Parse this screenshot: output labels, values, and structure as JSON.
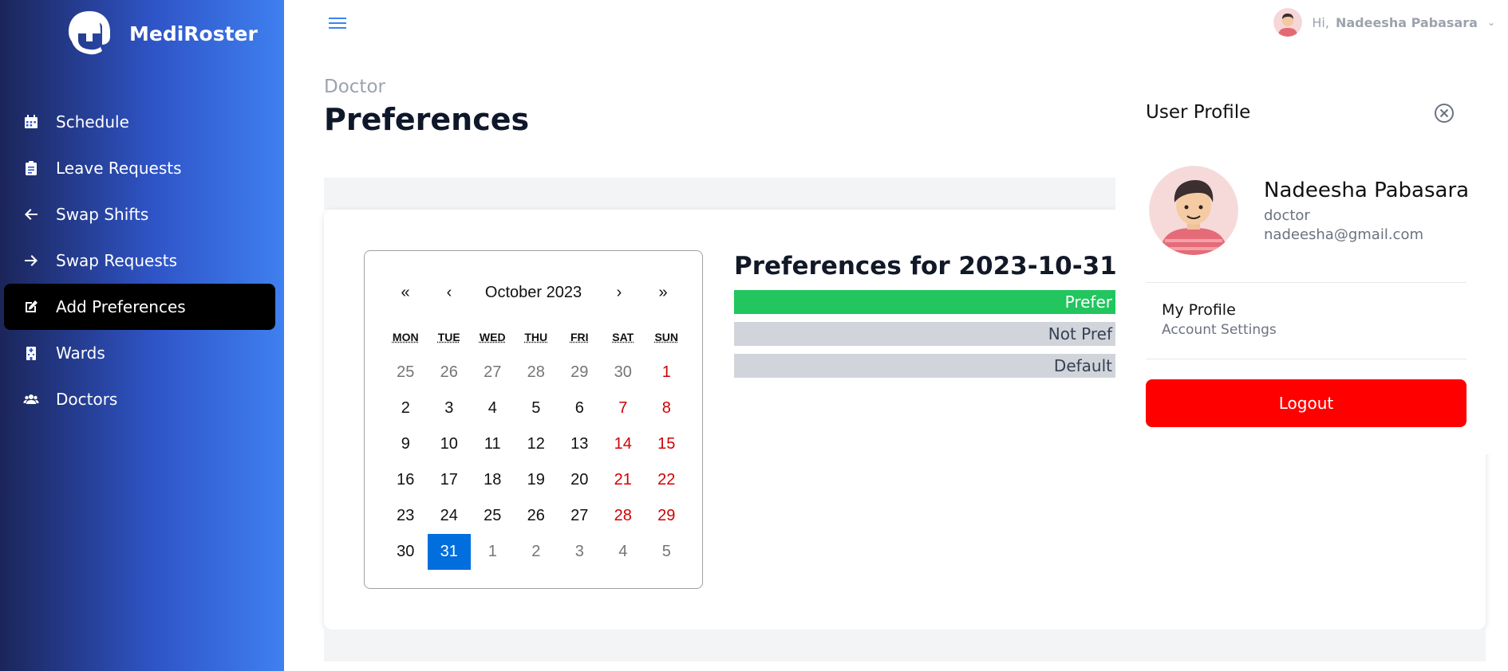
{
  "app": {
    "name": "MediRoster",
    "logo_icon": "mastodon-like-logo-icon",
    "accent_color": "#3b82f6"
  },
  "sidebar": {
    "items": [
      {
        "label": "Schedule",
        "icon": "calendar-icon"
      },
      {
        "label": "Leave Requests",
        "icon": "clipboard-icon"
      },
      {
        "label": "Swap Shifts",
        "icon": "arrow-left-icon"
      },
      {
        "label": "Swap Requests",
        "icon": "arrow-right-icon"
      },
      {
        "label": "Add Preferences",
        "icon": "edit-icon",
        "active": true
      },
      {
        "label": "Wards",
        "icon": "building-icon"
      },
      {
        "label": "Doctors",
        "icon": "users-icon"
      }
    ]
  },
  "topbar": {
    "greeting": "Hi,",
    "user_name": "Nadeesha Pabasara"
  },
  "page": {
    "breadcrumb": "Doctor",
    "title": "Preferences"
  },
  "calendar": {
    "prev_year": "«",
    "prev_month": "‹",
    "month_label": "October 2023",
    "next_month": "›",
    "next_year": "»",
    "weekdays": [
      "MON",
      "TUE",
      "WED",
      "THU",
      "FRI",
      "SAT",
      "SUN"
    ],
    "selected": "31",
    "weeks": [
      [
        [
          "25",
          "other"
        ],
        [
          "26",
          "other"
        ],
        [
          "27",
          "other"
        ],
        [
          "28",
          "other"
        ],
        [
          "29",
          "other"
        ],
        [
          "30",
          "other"
        ],
        [
          "1",
          "weekend"
        ]
      ],
      [
        [
          "2",
          ""
        ],
        [
          "3",
          ""
        ],
        [
          "4",
          ""
        ],
        [
          "5",
          ""
        ],
        [
          "6",
          ""
        ],
        [
          "7",
          "weekend"
        ],
        [
          "8",
          "weekend"
        ]
      ],
      [
        [
          "9",
          ""
        ],
        [
          "10",
          ""
        ],
        [
          "11",
          ""
        ],
        [
          "12",
          ""
        ],
        [
          "13",
          ""
        ],
        [
          "14",
          "weekend"
        ],
        [
          "15",
          "weekend"
        ]
      ],
      [
        [
          "16",
          ""
        ],
        [
          "17",
          ""
        ],
        [
          "18",
          ""
        ],
        [
          "19",
          ""
        ],
        [
          "20",
          ""
        ],
        [
          "21",
          "weekend"
        ],
        [
          "22",
          "weekend"
        ]
      ],
      [
        [
          "23",
          ""
        ],
        [
          "24",
          ""
        ],
        [
          "25",
          ""
        ],
        [
          "26",
          ""
        ],
        [
          "27",
          ""
        ],
        [
          "28",
          "weekend"
        ],
        [
          "29",
          "weekend"
        ]
      ],
      [
        [
          "30",
          ""
        ],
        [
          "31",
          "selected"
        ],
        [
          "1",
          "other"
        ],
        [
          "2",
          "other"
        ],
        [
          "3",
          "other"
        ],
        [
          "4",
          "other"
        ],
        [
          "5",
          "other"
        ]
      ]
    ]
  },
  "preferences": {
    "title": "Preferences for 2023-10-31",
    "options": [
      {
        "label": "Prefer",
        "color": "#22c55e"
      },
      {
        "label": "Not Pref",
        "color": "#d1d5db"
      },
      {
        "label": "Default",
        "color": "#d1d5db"
      }
    ]
  },
  "profile_panel": {
    "title": "User Profile",
    "name": "Nadeesha Pabasara",
    "role": "doctor",
    "email": "nadeesha@gmail.com",
    "my_profile": "My Profile",
    "account_settings": "Account Settings",
    "logout": "Logout",
    "logout_color": "#ff0000"
  }
}
